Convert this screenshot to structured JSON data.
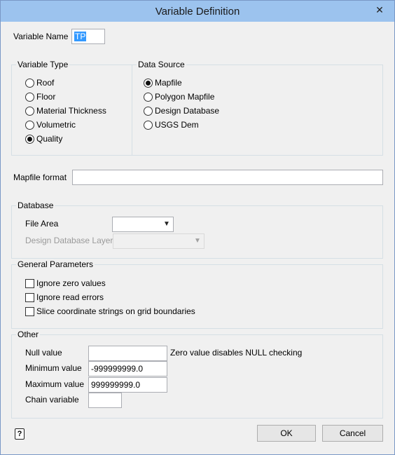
{
  "window": {
    "title": "Variable Definition",
    "close": "✕"
  },
  "variable_name": {
    "label": "Variable Name",
    "value": "TP"
  },
  "variable_type": {
    "title": "Variable Type",
    "options": [
      {
        "label": "Roof",
        "selected": false
      },
      {
        "label": "Floor",
        "selected": false
      },
      {
        "label": "Material Thickness",
        "selected": false
      },
      {
        "label": "Volumetric",
        "selected": false
      },
      {
        "label": "Quality",
        "selected": true
      }
    ]
  },
  "data_source": {
    "title": "Data Source",
    "options": [
      {
        "label": "Mapfile",
        "selected": true
      },
      {
        "label": "Polygon Mapfile",
        "selected": false
      },
      {
        "label": "Design Database",
        "selected": false
      },
      {
        "label": "USGS Dem",
        "selected": false
      }
    ]
  },
  "mapfile_format": {
    "label": "Mapfile format",
    "value": ""
  },
  "database": {
    "title": "Database",
    "file_area_label": "File Area",
    "file_area_value": "",
    "layer_label": "Design Database Layer",
    "layer_value": ""
  },
  "general": {
    "title": "General Parameters",
    "options": [
      {
        "label": "Ignore zero values",
        "checked": false
      },
      {
        "label": "Ignore read errors",
        "checked": false
      },
      {
        "label": "Slice coordinate strings on grid boundaries",
        "checked": false
      }
    ]
  },
  "other": {
    "title": "Other",
    "null_label": "Null value",
    "null_value": "",
    "null_hint": "Zero value disables NULL checking",
    "min_label": "Minimum value",
    "min_value": "-999999999.0",
    "max_label": "Maximum value",
    "max_value": "999999999.0",
    "chain_label": "Chain variable",
    "chain_value": ""
  },
  "footer": {
    "help": "?",
    "ok": "OK",
    "cancel": "Cancel"
  }
}
